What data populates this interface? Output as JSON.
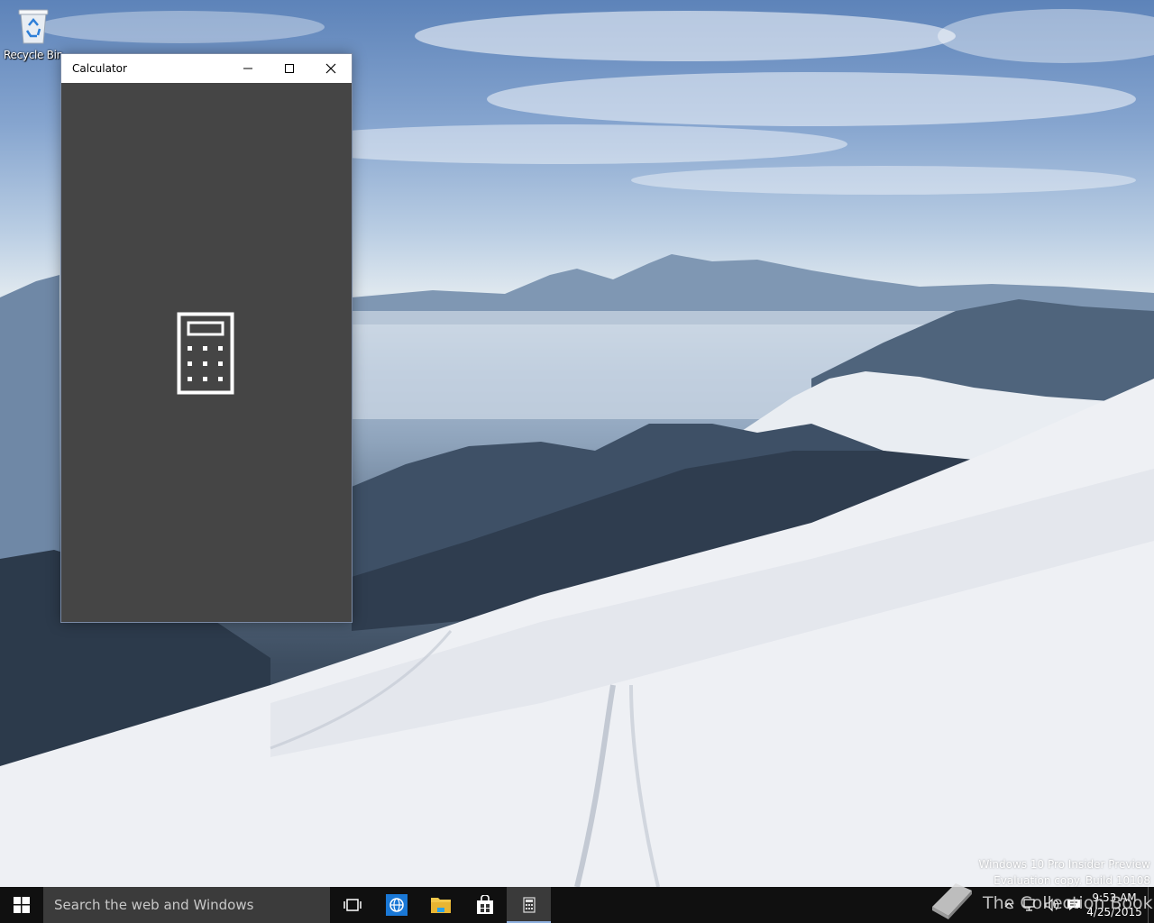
{
  "desktop": {
    "icons": [
      {
        "label": "Recycle Bin",
        "icon": "recycle-bin-icon"
      }
    ]
  },
  "window": {
    "title": "Calculator",
    "controls": {
      "minimize": "minimize-icon",
      "maximize": "maximize-icon",
      "close": "close-icon"
    },
    "splash_icon": "calculator-icon",
    "body_color": "#454545"
  },
  "watermark": {
    "line1": "Windows 10 Pro Insider Preview",
    "line2": "Evaluation copy. Build 10108"
  },
  "taskbar": {
    "search_placeholder": "Search the web and Windows",
    "buttons": [
      {
        "name": "task-view",
        "icon": "task-view-icon"
      },
      {
        "name": "internet-explorer",
        "icon": "globe-icon"
      },
      {
        "name": "file-explorer",
        "icon": "folder-icon"
      },
      {
        "name": "store",
        "icon": "store-bag-icon"
      },
      {
        "name": "calculator",
        "icon": "calculator-icon",
        "active": true
      }
    ],
    "tray": {
      "time": "9:53 AM",
      "date": "4/25/2015"
    },
    "accent_color": "#8fb1e0"
  },
  "brand_overlay": {
    "text": "The Collection Book"
  }
}
